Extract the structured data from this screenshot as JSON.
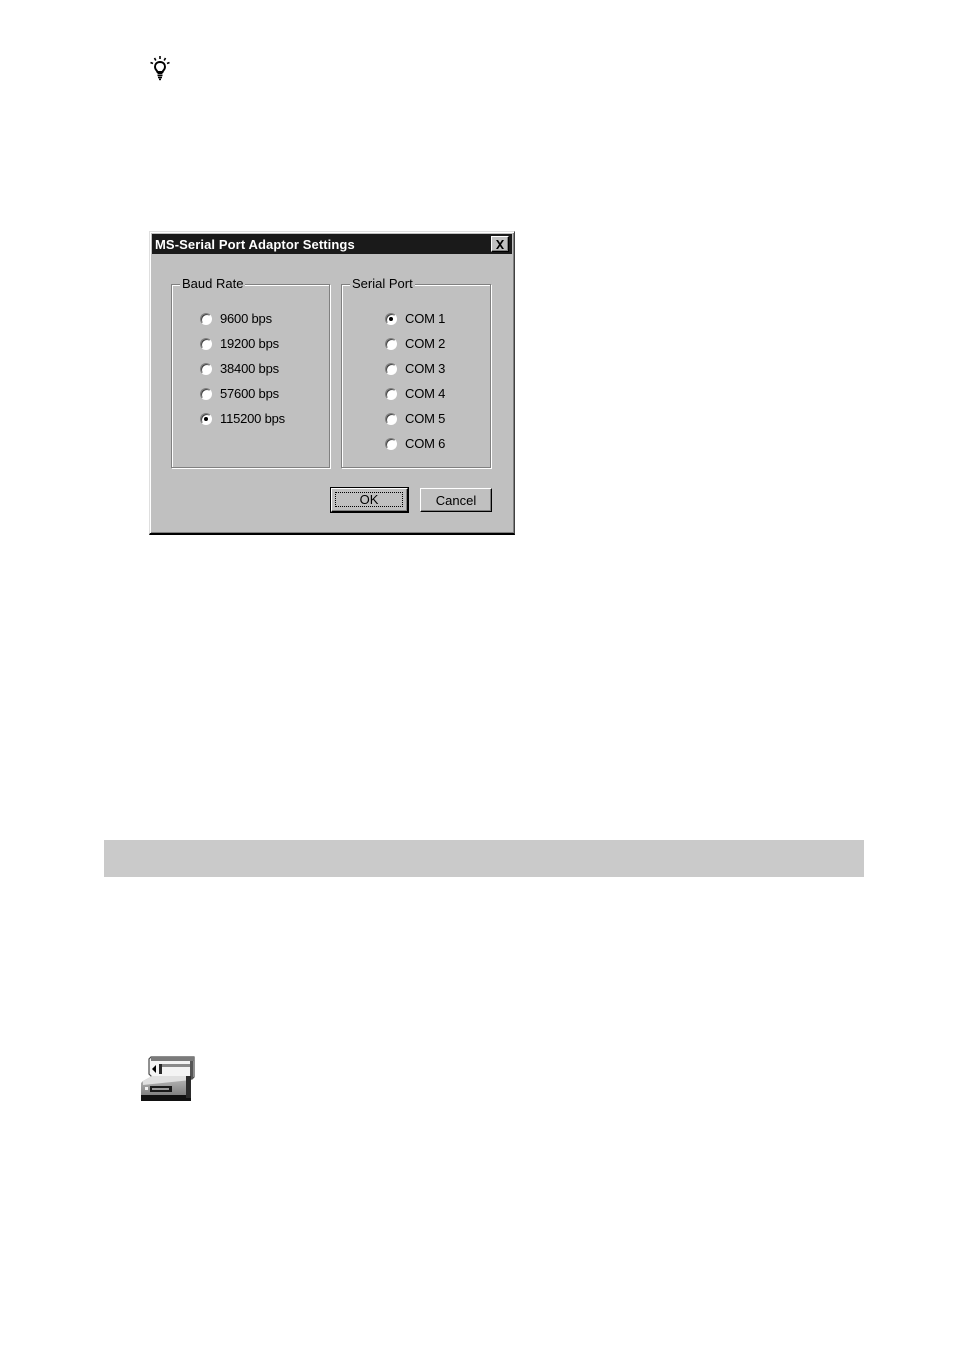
{
  "page": {
    "tip_icon": "lightbulb-tip-icon",
    "section_bar_color": "#cacaca",
    "adaptor_icon": "memory-stick-adaptor-icon"
  },
  "dialog": {
    "title": "MS-Serial Port Adaptor Settings",
    "close_icon": "close-icon",
    "titlebar_color": "#1a1a1a",
    "face_color": "#c0c0c0",
    "baud_rate": {
      "legend": "Baud Rate",
      "options": [
        {
          "label": "9600 bps",
          "selected": false
        },
        {
          "label": "19200 bps",
          "selected": false
        },
        {
          "label": "38400 bps",
          "selected": false
        },
        {
          "label": "57600 bps",
          "selected": false
        },
        {
          "label": "115200 bps",
          "selected": true
        }
      ]
    },
    "serial_port": {
      "legend": "Serial Port",
      "options": [
        {
          "label": "COM 1",
          "selected": true
        },
        {
          "label": "COM 2",
          "selected": false
        },
        {
          "label": "COM 3",
          "selected": false
        },
        {
          "label": "COM 4",
          "selected": false
        },
        {
          "label": "COM 5",
          "selected": false
        },
        {
          "label": "COM 6",
          "selected": false
        }
      ]
    },
    "buttons": {
      "ok": "OK",
      "cancel": "Cancel"
    }
  }
}
